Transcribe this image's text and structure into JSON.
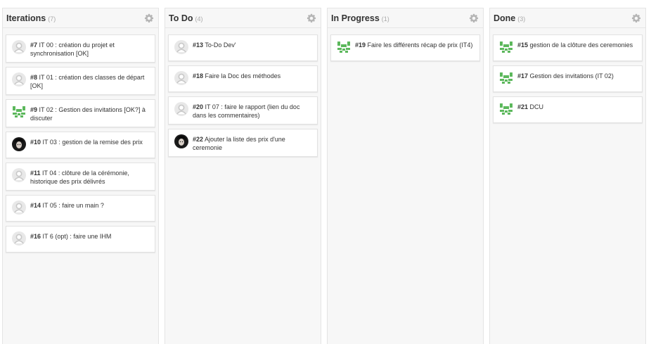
{
  "columns": [
    {
      "title": "Iterations",
      "count": "(7)",
      "cards": [
        {
          "number": "#7",
          "text": " IT 00 : création du projet et synchronisation [OK]",
          "avatar": "default"
        },
        {
          "number": "#8",
          "text": " IT 01 : création des classes de départ [OK]",
          "avatar": "default"
        },
        {
          "number": "#9",
          "text": " IT 02 : Gestion des invitations [OK?] à discuter",
          "avatar": "green"
        },
        {
          "number": "#10",
          "text": " IT 03 : gestion de la remise des prix",
          "avatar": "photo"
        },
        {
          "number": "#11",
          "text": " IT 04 : clôture de la cérémonie, historique des prix délivrés",
          "avatar": "default"
        },
        {
          "number": "#14",
          "text": " IT 05 : faire un main ?",
          "avatar": "default"
        },
        {
          "number": "#16",
          "text": " IT 6 (opt) : faire une IHM",
          "avatar": "default"
        }
      ]
    },
    {
      "title": "To Do",
      "count": "(4)",
      "cards": [
        {
          "number": "#13",
          "text": " To-Do Dev'",
          "avatar": "default"
        },
        {
          "number": "#18",
          "text": " Faire la Doc des méthodes",
          "avatar": "default"
        },
        {
          "number": "#20",
          "text": " IT 07 : faire le rapport (lien du doc dans les commentaires)",
          "avatar": "default"
        },
        {
          "number": "#22",
          "text": " Ajouter la liste des prix d'une ceremonie",
          "avatar": "photo"
        }
      ]
    },
    {
      "title": "In Progress",
      "count": "(1)",
      "cards": [
        {
          "number": "#19",
          "text": " Faire les différents récap de prix (IT4)",
          "avatar": "green"
        }
      ]
    },
    {
      "title": "Done",
      "count": "(3)",
      "cards": [
        {
          "number": "#15",
          "text": " gestion de la clôture des ceremonies",
          "avatar": "green"
        },
        {
          "number": "#17",
          "text": " Gestion des invitations (IT 02)",
          "avatar": "green"
        },
        {
          "number": "#21",
          "text": " DCU",
          "avatar": "green"
        }
      ]
    }
  ],
  "colors": {
    "column_bg": "#f7f7f7",
    "green_avatar": "#5cb85c",
    "default_avatar": "#c8c8c8",
    "gear": "#b5b5b5"
  }
}
